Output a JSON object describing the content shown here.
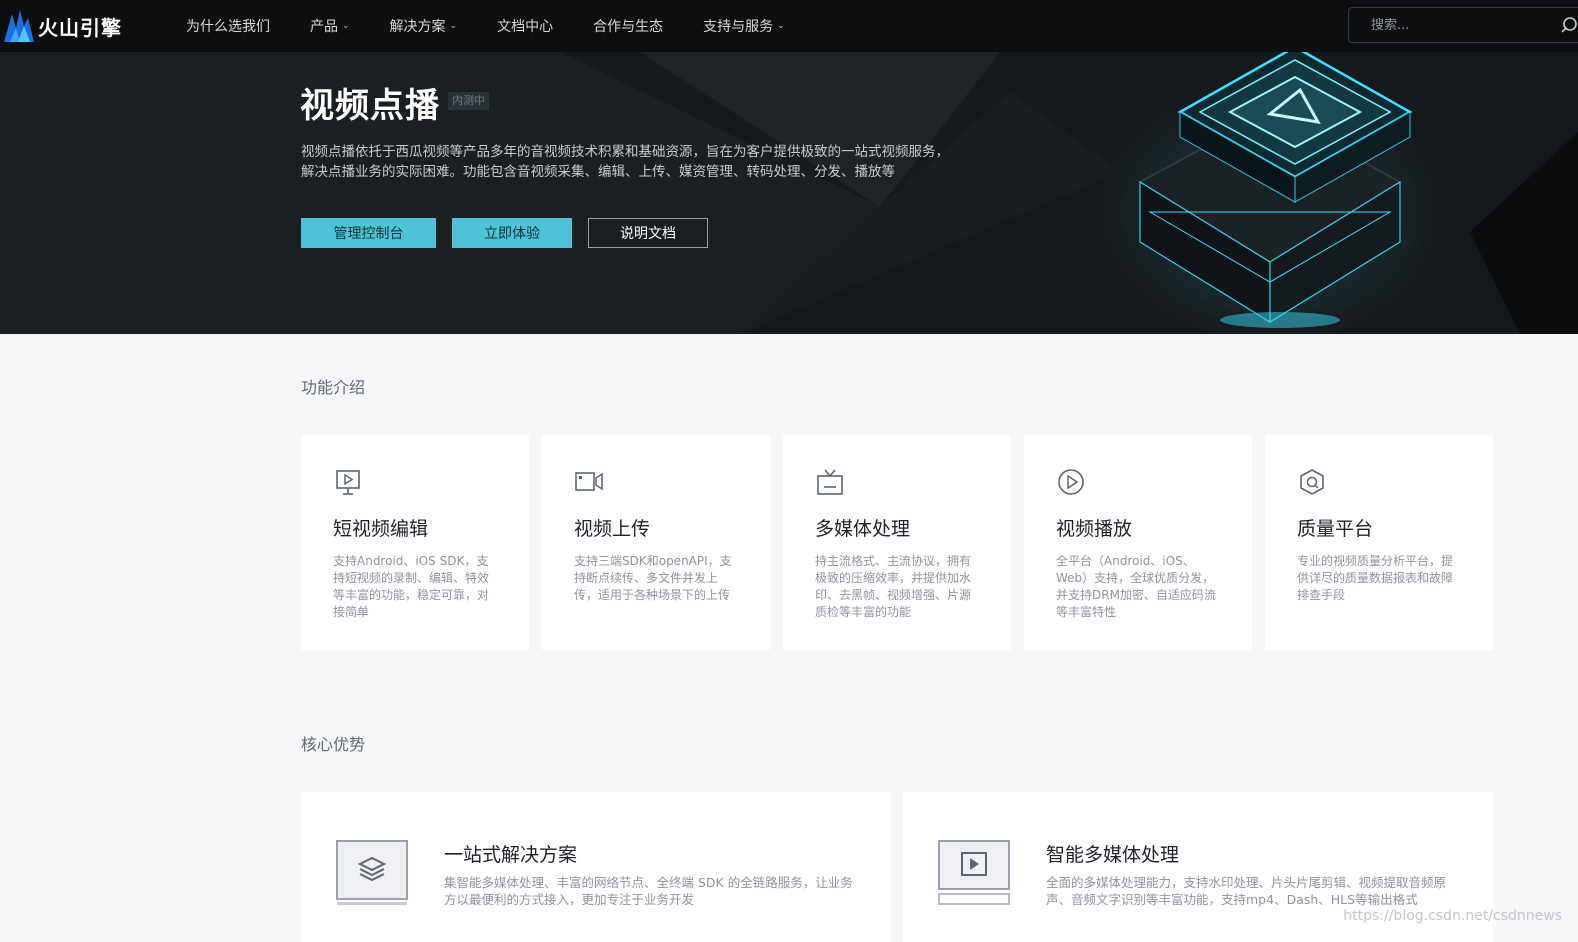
{
  "nav": {
    "logo_text": "火山引擎",
    "items": [
      {
        "label": "为什么选我们",
        "has_caret": false
      },
      {
        "label": "产品",
        "has_caret": true
      },
      {
        "label": "解决方案",
        "has_caret": true
      },
      {
        "label": "文档中心",
        "has_caret": false
      },
      {
        "label": "合作与生态",
        "has_caret": false
      },
      {
        "label": "支持与服务",
        "has_caret": true
      }
    ],
    "caret_glyph": "⌄",
    "search_placeholder": "搜索..."
  },
  "hero": {
    "title": "视频点播",
    "badge": "内测中",
    "description": "视频点播依托于西瓜视频等产品多年的音视频技术积累和基础资源，旨在为客户提供极致的一站式视频服务，解决点播业务的实际困难。功能包含音视频采集、编辑、上传、媒资管理、转码处理、分发、播放等",
    "buttons": {
      "console": "管理控制台",
      "try_now": "立即体验",
      "docs": "说明文档"
    }
  },
  "features": {
    "section_title": "功能介绍",
    "cards": [
      {
        "icon": "presentation-play-icon",
        "title": "短视频编辑",
        "desc": "支持Android、iOS SDK，支持短视频的录制、编辑、特效等丰富的功能，稳定可靠，对接简单"
      },
      {
        "icon": "video-camera-icon",
        "title": "视频上传",
        "desc": "支持三端SDK和openAPI，支持断点续传、多文件并发上传，适用于各种场景下的上传"
      },
      {
        "icon": "tv-icon",
        "title": "多媒体处理",
        "desc": "持主流格式、主流协议，拥有极致的压缩效率，并提供加水印、去黑帧、视频增强、片源质检等丰富的功能"
      },
      {
        "icon": "play-circle-icon",
        "title": "视频播放",
        "desc": "全平台（Android、iOS、Web）支持，全球优质分发，并支持DRM加密、自适应码流等丰富特性"
      },
      {
        "icon": "quality-shield-icon",
        "title": "质量平台",
        "desc": "专业的视频质量分析平台，提供详尽的质量数据报表和故障排查手段"
      }
    ]
  },
  "advantages": {
    "section_title": "核心优势",
    "cards": [
      {
        "icon": "layers-icon",
        "title": "一站式解决方案",
        "desc": "集智能多媒体处理、丰富的网络节点、全终端 SDK 的全链路服务，让业务方以最便利的方式接入，更加专注于业务开发"
      },
      {
        "icon": "media-player-icon",
        "title": "智能多媒体处理",
        "desc": "全面的多媒体处理能力，支持水印处理、片头片尾剪辑、视频提取音频原声、音频文字识别等丰富功能，支持mp4、Dash、HLS等输出格式"
      }
    ]
  },
  "watermark": "https://blog.csdn.net/csdnnews",
  "colors": {
    "accent": "#4fc3d6",
    "nav_bg": "#0d0f10",
    "hero_bg": "#15191c",
    "page_bg": "#f6f7f8"
  }
}
